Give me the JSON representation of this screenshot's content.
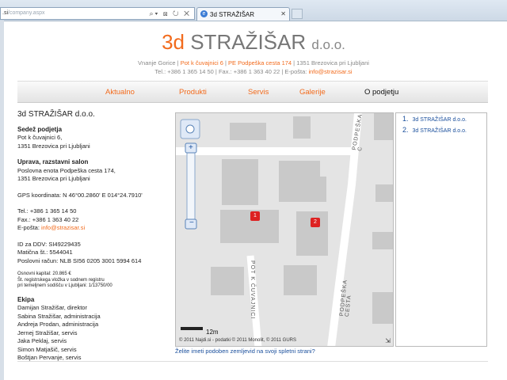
{
  "browser": {
    "address_prefix": ".si",
    "address_path": "/company.aspx",
    "tab_title": "3d STRAŽIŠAR"
  },
  "header": {
    "brand_3d": "3d",
    "brand_name": "STRAŽIŠAR",
    "brand_suffix": "d.o.o.",
    "line1_a": "Vnanje Gorice | ",
    "line1_b": "Pot k čuvajnici 6",
    "line1_c": " | ",
    "line1_d": "PE Podpeška cesta 174",
    "line1_e": " | 1351 Brezovica pri Ljubljani",
    "line2_a": "Tel.: +386 1 365 14 50 | Fax.: +386 1 363 40 22 | E-pošta: ",
    "line2_email": "info@strazisar.si"
  },
  "nav": {
    "items": [
      "Aktualno",
      "Produkti",
      "Servis",
      "Galerije",
      "O podjetju"
    ]
  },
  "company": {
    "name": "3d STRAŽIŠAR d.o.o.",
    "hq_heading": "Sedež podjetja",
    "hq_line1": "Pot k čuvajnici 6,",
    "hq_line2": "1351 Brezovica pri Ljubljani",
    "salon_heading": "Uprava, razstavni salon",
    "salon_line1": "Poslovna enota Podpeška cesta 174,",
    "salon_line2": "1351 Brezovica pri Ljubljani",
    "gps": "GPS koordinata: N 46°00.2860' E 014°24.7910'",
    "tel": "Tel.: +386 1 365 14 50",
    "fax": "Fax.: +386 1 363 40 22",
    "email_label": "E-pošta: ",
    "email": "info@strazisar.si",
    "ddv": "ID za DDV: SI49229435",
    "maticna": "Matična št.: 5544041",
    "racun": "Poslovni račun: NLB SI56 0205 3001 5994 614",
    "kapital_1": "Osnovni kapital: 20.865 €",
    "kapital_2": "Št. registrskega vložka v sodnem registru",
    "kapital_3": "pri temeljnem sodišču v Ljubljani: 1/13750/00",
    "team_heading": "Ekipa",
    "team": [
      "Damijan Stražišar, direktor",
      "Sabina Stražišar, administracija",
      "Andreja Prodan, administracija",
      "Jernej Stražišar, servis",
      "Jaka Peklaj, servis",
      "Simon Matjašič, servis",
      "Boštjan Pervanje, servis"
    ]
  },
  "map": {
    "street_1": "PODPEŠKA C",
    "street_2": "POT K ČUVAJNICI",
    "street_3": "PODPEŠKA CESTA",
    "marker_1": "1",
    "marker_2": "2",
    "scale": "12m",
    "copyright": "© 2011 Najdi.si - podatki © 2011 Monolit, © 2011 GURS",
    "footer_link": "Želite imeti podoben zemljevid na svoji spletni strani?"
  },
  "locations": [
    {
      "num": "1.",
      "label": "3d STRAŽIŠAR d.o.o."
    },
    {
      "num": "2.",
      "label": "3d STRAŽIŠAR d.o.o."
    }
  ],
  "colors": {
    "accent": "#f26b1d",
    "link": "#1a4f9c"
  }
}
